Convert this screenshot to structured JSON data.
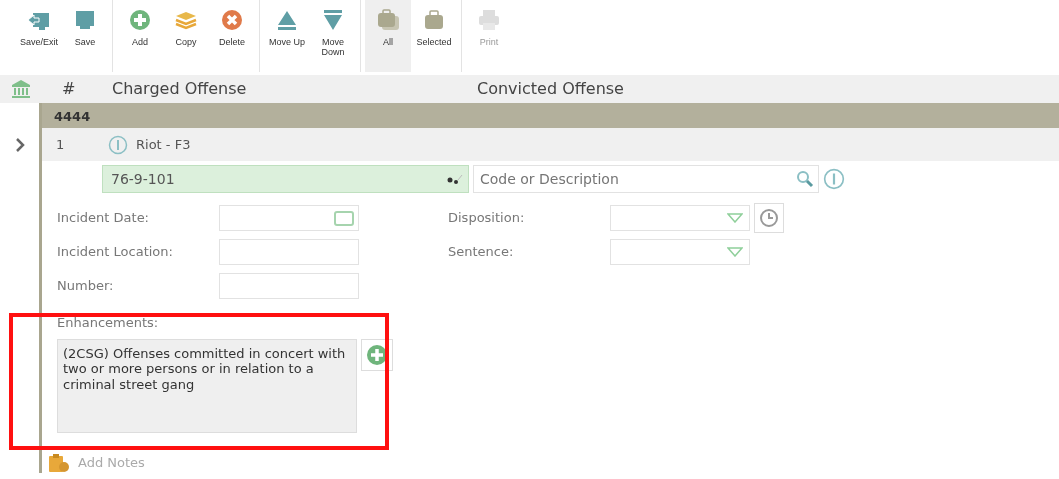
{
  "toolbar": [
    {
      "label": "Save/Exit",
      "kind": "exit",
      "selected": false,
      "disabled": false
    },
    {
      "label": "Save",
      "kind": "save",
      "selected": false,
      "disabled": false
    },
    {
      "label": "Add",
      "kind": "add",
      "selected": false,
      "disabled": false
    },
    {
      "label": "Copy",
      "kind": "copy",
      "selected": false,
      "disabled": false
    },
    {
      "label": "Delete",
      "kind": "delete",
      "selected": false,
      "disabled": false
    },
    {
      "label": "Move Up",
      "kind": "up",
      "selected": false,
      "disabled": false
    },
    {
      "label": "Move Down",
      "kind": "down",
      "selected": false,
      "disabled": false
    },
    {
      "label": "All",
      "kind": "all",
      "selected": true,
      "disabled": false
    },
    {
      "label": "Selected",
      "kind": "selected",
      "selected": false,
      "disabled": false
    },
    {
      "label": "Print",
      "kind": "print",
      "selected": false,
      "disabled": true
    }
  ],
  "columns": [
    "#",
    "Charged Offense",
    "Convicted Offense"
  ],
  "group": {
    "label": "4444"
  },
  "offense": {
    "number": "1",
    "description": "Riot - F3",
    "code": "76-9-101",
    "convicted_placeholder": "Code or Description"
  },
  "fields_left": [
    {
      "label": "Incident Date:",
      "kind": "date"
    },
    {
      "label": "Incident Location:",
      "kind": "text"
    },
    {
      "label": "Number:",
      "kind": "text"
    }
  ],
  "fields_right": [
    {
      "label": "Disposition:",
      "kind": "select-history"
    },
    {
      "label": "Sentence:",
      "kind": "select"
    }
  ],
  "enhancements": {
    "label": "Enhancements:",
    "value": "(2CSG) Offenses committed in concert with two or more persons or in relation to a criminal street gang"
  },
  "add_notes": "Add Notes"
}
